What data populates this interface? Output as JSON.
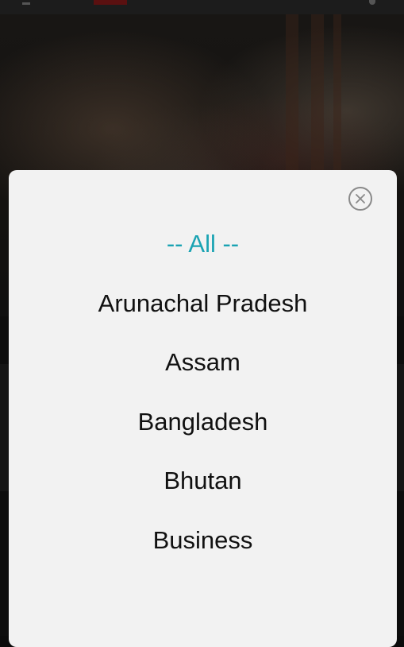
{
  "background": {
    "dimmed": true,
    "icons": [
      "menu-icon",
      "search-icon"
    ]
  },
  "modal": {
    "close_icon": "close-icon",
    "options": [
      {
        "label": "-- All --",
        "selected": true
      },
      {
        "label": "Arunachal Pradesh",
        "selected": false
      },
      {
        "label": "Assam",
        "selected": false
      },
      {
        "label": "Bangladesh",
        "selected": false
      },
      {
        "label": "Bhutan",
        "selected": false
      },
      {
        "label": "Business",
        "selected": false
      }
    ]
  },
  "colors": {
    "selected_option": "#1aa3b3",
    "option_text": "#111111",
    "modal_background": "#f2f2f2",
    "close_icon": "#8a8a8a"
  }
}
